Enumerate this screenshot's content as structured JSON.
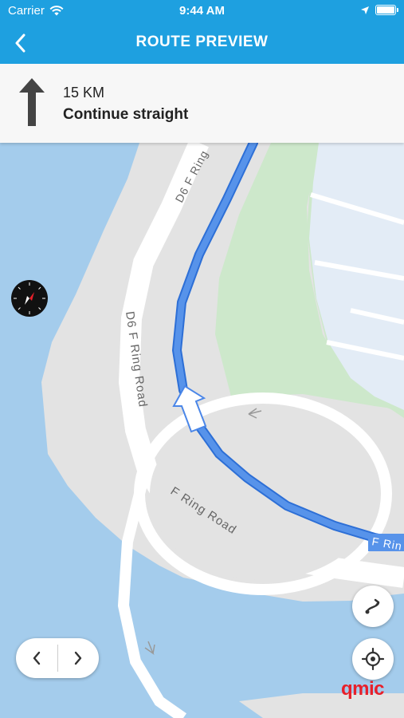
{
  "status_bar": {
    "carrier": "Carrier",
    "time": "9:44 AM"
  },
  "nav": {
    "title": "ROUTE PREVIEW",
    "back_icon": "chevron-left-icon"
  },
  "instruction": {
    "distance": "15 KM",
    "text": "Continue straight",
    "icon": "straight-arrow-icon"
  },
  "map": {
    "roads": [
      "D6 F Ring",
      "D6 F Ring Road",
      "F Ring Road",
      "F Rin"
    ],
    "colors": {
      "water": "#a4ccec",
      "land": "#e3e3e3",
      "park": "#cde8cb",
      "block": "#e3ecf6",
      "route": "#4a86e8",
      "road": "#ffffff"
    }
  },
  "controls": {
    "prev_icon": "chevron-left-icon",
    "next_icon": "chevron-right-icon",
    "reroute_icon": "reroute-icon",
    "locate_icon": "locate-icon",
    "compass_icon": "compass-icon"
  },
  "logo": {
    "text": "qmic"
  },
  "colors": {
    "header": "#1ea0e0",
    "logo": "#e8202a"
  }
}
